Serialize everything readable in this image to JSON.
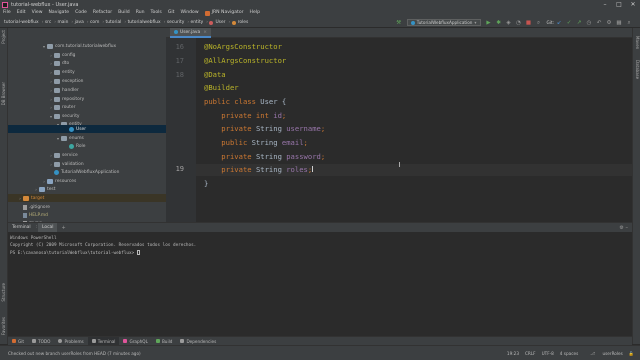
{
  "titlebar": {
    "project": "tutorial-webflux",
    "file": "User.java",
    "separator": " - ",
    "controls": [
      "–",
      "□",
      "✕"
    ]
  },
  "menu": [
    "File",
    "Edit",
    "View",
    "Navigate",
    "Code",
    "Refactor",
    "Build",
    "Run",
    "Tools",
    "Git",
    "Window",
    "JRN Navigator",
    "Help"
  ],
  "breadcrumbs": [
    "tutorial-webflux",
    "src",
    "main",
    "java",
    "com",
    "tutorial",
    "tutorialwebflux",
    "security",
    "entity",
    "User",
    "roles"
  ],
  "toolbar": {
    "run_config": "TutorialWebfluxApplication",
    "git_label": "Git:"
  },
  "left_strip": [
    "Project",
    "DB Browser",
    "Structure",
    "Favorites"
  ],
  "right_strip": [
    "Maven",
    "Database"
  ],
  "project_tree": [
    {
      "label": "com.tutorial.tutorialwebflux",
      "depth": 2,
      "icon": "package",
      "expanded": true
    },
    {
      "label": "config",
      "depth": 3,
      "icon": "package",
      "expanded": false
    },
    {
      "label": "dto",
      "depth": 3,
      "icon": "package",
      "expanded": false
    },
    {
      "label": "entity",
      "depth": 3,
      "icon": "package",
      "expanded": false
    },
    {
      "label": "exception",
      "depth": 3,
      "icon": "package",
      "expanded": false
    },
    {
      "label": "handler",
      "depth": 3,
      "icon": "package",
      "expanded": false
    },
    {
      "label": "repository",
      "depth": 3,
      "icon": "package",
      "expanded": false
    },
    {
      "label": "router",
      "depth": 3,
      "icon": "package",
      "expanded": false
    },
    {
      "label": "security",
      "depth": 3,
      "icon": "package",
      "expanded": true
    },
    {
      "label": "entity",
      "depth": 4,
      "icon": "package",
      "expanded": true
    },
    {
      "label": "User",
      "depth": 5,
      "icon": "class",
      "selected": true
    },
    {
      "label": "enums",
      "depth": 4,
      "icon": "package",
      "expanded": true
    },
    {
      "label": "Role",
      "depth": 5,
      "icon": "enum"
    },
    {
      "label": "service",
      "depth": 3,
      "icon": "package",
      "expanded": false
    },
    {
      "label": "validation",
      "depth": 3,
      "icon": "package",
      "expanded": false
    },
    {
      "label": "TutorialWebfluxApplication",
      "depth": 3,
      "icon": "app"
    },
    {
      "label": "resources",
      "depth": 2,
      "icon": "folder",
      "expanded": false
    },
    {
      "label": "test",
      "depth": 1,
      "icon": "folder",
      "expanded": false
    },
    {
      "label": "target",
      "depth": 0,
      "icon": "folder-orange",
      "expanded": false,
      "ignored": true
    },
    {
      "label": ".gitignore",
      "depth": 0,
      "icon": "file"
    },
    {
      "label": "HELP.md",
      "depth": 0,
      "icon": "file",
      "color": "yellowish"
    },
    {
      "label": "mvnw",
      "depth": 0,
      "icon": "file"
    }
  ],
  "editor": {
    "tab_label": "User.java",
    "tab_close": "×",
    "current_line": 19,
    "lines": [
      {
        "n": "16",
        "code": [
          {
            "t": "@NoArgsConstructor",
            "k": "ann"
          }
        ]
      },
      {
        "n": "17",
        "code": [
          {
            "t": "@AllArgsConstructor",
            "k": "ann"
          }
        ]
      },
      {
        "n": "18",
        "code": [
          {
            "t": "@Data",
            "k": "ann"
          }
        ]
      },
      {
        "n": "",
        "code": [
          {
            "t": "@Builder",
            "k": "ann"
          }
        ]
      },
      {
        "n": "",
        "code": [
          {
            "t": "public class ",
            "k": "kw"
          },
          {
            "t": "User {",
            "k": "plain"
          }
        ]
      },
      {
        "n": "",
        "code": [
          {
            "t": "    private int ",
            "k": "kw"
          },
          {
            "t": "id",
            "k": "fld"
          },
          {
            "t": ";",
            "k": "kw"
          }
        ]
      },
      {
        "n": "",
        "code": [
          {
            "t": "    private ",
            "k": "kw"
          },
          {
            "t": "String ",
            "k": "plain"
          },
          {
            "t": "username",
            "k": "fld"
          },
          {
            "t": ";",
            "k": "kw"
          }
        ]
      },
      {
        "n": "",
        "code": [
          {
            "t": "    public ",
            "k": "kw"
          },
          {
            "t": "String ",
            "k": "plain"
          },
          {
            "t": "email",
            "k": "fld"
          },
          {
            "t": ";",
            "k": "kw"
          }
        ]
      },
      {
        "n": "",
        "code": [
          {
            "t": "    private ",
            "k": "kw"
          },
          {
            "t": "String ",
            "k": "plain"
          },
          {
            "t": "password",
            "k": "fld"
          },
          {
            "t": ";",
            "k": "kw"
          }
        ]
      },
      {
        "n": "19",
        "code": [
          {
            "t": "    private ",
            "k": "kw"
          },
          {
            "t": "String ",
            "k": "plain"
          },
          {
            "t": "roles",
            "k": "fld"
          },
          {
            "t": ";",
            "k": "kw"
          }
        ]
      },
      {
        "n": "",
        "code": [
          {
            "t": "}",
            "k": "plain"
          }
        ]
      }
    ]
  },
  "terminal": {
    "title": "Terminal",
    "tab": "Local",
    "add": "+",
    "lines": [
      "Windows PowerShell",
      "Copyright (C) 2009 Microsoft Corporation. Reservados todos los derechos.",
      "",
      "PS E:\\cavanosa\\tutorialWebflux\\tutorial-webflux> "
    ],
    "controls": "⚙  –"
  },
  "tool_tabs": [
    {
      "label": "Git",
      "color": "#d26c32"
    },
    {
      "label": "TODO",
      "color": "#9a9a9a"
    },
    {
      "label": "Problems",
      "color": "#9a9a9a"
    },
    {
      "label": "Terminal",
      "color": "#9a9a9a",
      "active": true
    },
    {
      "label": "GraphQL",
      "color": "#e0559b"
    },
    {
      "label": "Build",
      "color": "#5fa65a"
    },
    {
      "label": "Dependencies",
      "color": "#9a9a9a"
    }
  ],
  "statusbar": {
    "message": "Checked out new branch userRoles from HEAD (7 minutes ago)",
    "position": "19:23",
    "line_sep": "CRLF",
    "encoding": "UTF-8",
    "indent": "4 spaces",
    "branch": "userRoles"
  }
}
